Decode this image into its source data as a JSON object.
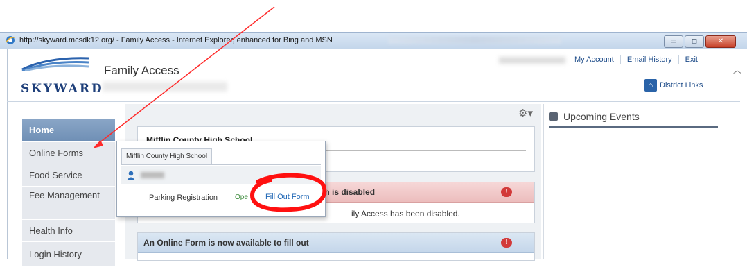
{
  "window": {
    "title": "http://skyward.mcsdk12.org/ - Family Access - Internet Explorer, enhanced for Bing and MSN",
    "buttons": {
      "minimize": "▭",
      "maximize": "◻",
      "close": "✕"
    }
  },
  "header": {
    "logo_text": "SKYWARD",
    "brand": "Family Access",
    "links": [
      "My Account",
      "Email History",
      "Exit"
    ],
    "district_link": "District Links",
    "district_icon": "school-building-icon"
  },
  "sidebar": {
    "items": [
      {
        "label": "Home",
        "active": true
      },
      {
        "label": "Online Forms"
      },
      {
        "label": "Food Service"
      },
      {
        "label": "Fee Management"
      },
      {
        "label": "Health Info"
      },
      {
        "label": "Login History"
      }
    ]
  },
  "main": {
    "card1": {
      "school": "Mifflin County High School"
    },
    "card2": {
      "heading": "m is disabled",
      "body": "ily Access has been disabled."
    },
    "card3": {
      "heading": "An Online Form is now available to fill out"
    }
  },
  "popup": {
    "tab": "Mifflin County High School",
    "form_name": "Parking Registration",
    "status": "Ope",
    "action": "Fill Out Form"
  },
  "events": {
    "heading": "Upcoming Events"
  },
  "colors": {
    "annotation": "#ff0000",
    "link": "#1e66b5",
    "sidebar_active": "#7b98bd"
  }
}
